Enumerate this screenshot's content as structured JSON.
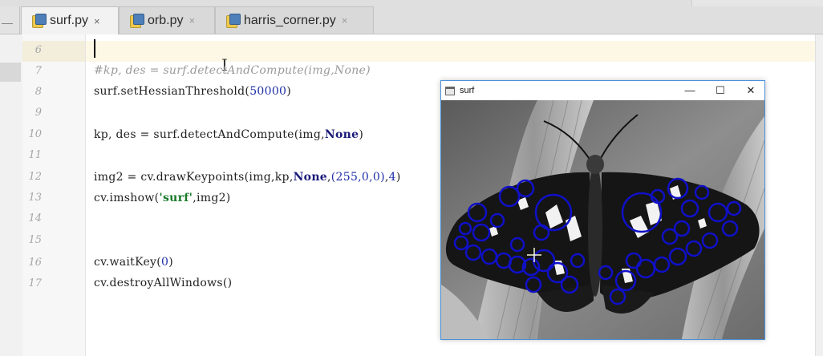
{
  "tabs": [
    {
      "label": "surf.py",
      "active": true,
      "close": "×"
    },
    {
      "label": "orb.py",
      "active": false,
      "close": "×"
    },
    {
      "label": "harris_corner.py",
      "active": false,
      "close": "×"
    }
  ],
  "editor": {
    "lines": [
      {
        "num": "6"
      },
      {
        "num": "7"
      },
      {
        "num": "8"
      },
      {
        "num": "9"
      },
      {
        "num": "10"
      },
      {
        "num": "11"
      },
      {
        "num": "12"
      },
      {
        "num": "13"
      },
      {
        "num": "14"
      },
      {
        "num": "15"
      },
      {
        "num": "16"
      },
      {
        "num": "17"
      }
    ],
    "code": {
      "l7_comment": "#kp, des = surf.detectAndCompute(img,None)",
      "l8_a": "surf.setHessianThreshold(",
      "l8_num": "50000",
      "l8_b": ")",
      "l10_a": "kp, des = surf.detectAndCompute(img,",
      "l10_kw": "None",
      "l10_b": ")",
      "l12_a": "img2 = cv.drawKeypoints(img,kp,",
      "l12_kw": "None",
      "l12_b": ",",
      "l12_tuple": "(255,0,0)",
      "l12_c": ",",
      "l12_num": "4",
      "l12_d": ")",
      "l13_a": "cv.imshow(",
      "l13_str": "'surf'",
      "l13_b": ",img2)",
      "l16_a": "cv.waitKey(",
      "l16_num": "0",
      "l16_b": ")",
      "l17": "cv.destroyAllWindows()"
    }
  },
  "image_window": {
    "title": "surf",
    "minimize": "—",
    "maximize": "☐",
    "close": "✕",
    "keypoint_color": "#1010c8"
  },
  "colors": {
    "accent_border": "#4a90d9",
    "current_line": "#fdf8e6",
    "number": "#1f2fa8",
    "string": "#1a7a2a",
    "comment": "#9a9a9a"
  }
}
